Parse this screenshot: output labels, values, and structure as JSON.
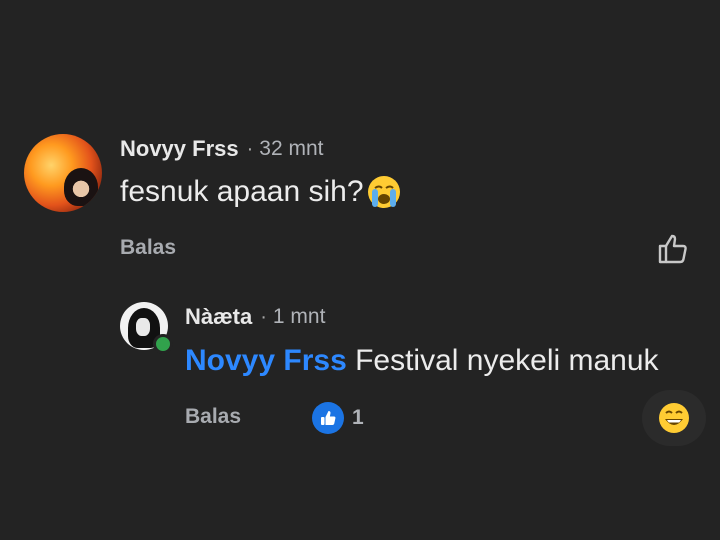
{
  "colors": {
    "background": "#232323",
    "mention": "#2d88ff",
    "like_badge": "#1b74e4",
    "online": "#31a24c"
  },
  "comment": {
    "author": "Novyy Frss",
    "separator": "·",
    "time": "32 mnt",
    "text": "fesnuk apaan sih?",
    "emoji": "loudly-crying-face-icon",
    "reply_label": "Balas",
    "like_icon": "thumbs-up-outline-icon"
  },
  "reply": {
    "author": "Nàæta",
    "separator": "·",
    "time": "1 mnt",
    "mention": "Novyy Frss",
    "text": " Festival nyekeli manuk",
    "reply_label": "Balas",
    "reaction_icon": "like-badge-icon",
    "reaction_count": "1",
    "react_emoji": "grinning-face-icon"
  }
}
